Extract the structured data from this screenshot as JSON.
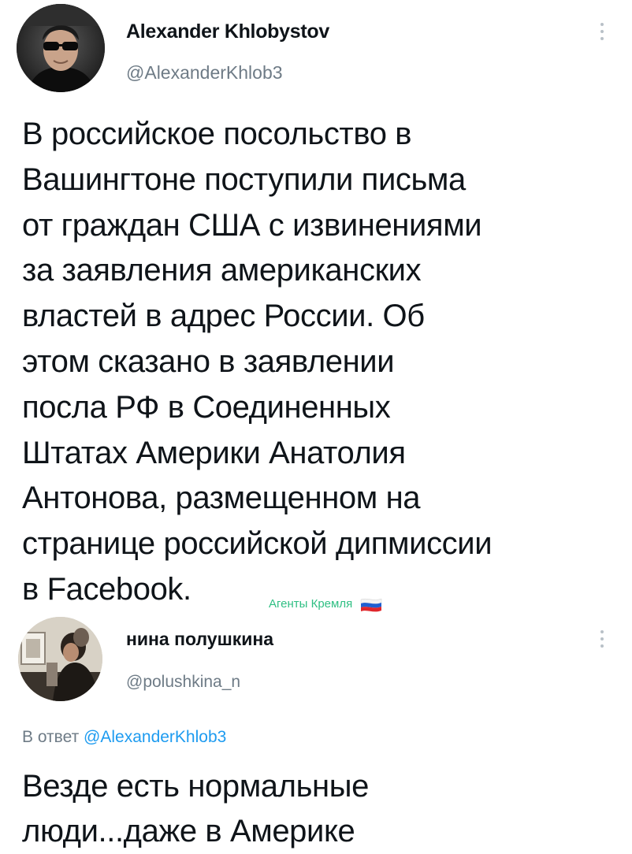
{
  "tweet1": {
    "author_name": "Alexander Khlobystov",
    "author_handle": "@AlexanderKhlob3",
    "text_lines": [
      "В российское посольство в",
      "Вашингтоне поступили письма",
      "от граждан США с извинениями",
      "за заявления американских",
      "властей в адрес России. Об",
      "этом сказано в заявлении",
      "посла РФ в Соединенных",
      "Штатах Америки Анатолия",
      "Антонова, размещенном на",
      "странице российской дипмиссии",
      "в Facebook."
    ],
    "more_icon": "more-vertical-icon"
  },
  "watermark": {
    "label": "Агенты Кремля",
    "flag_icon": "russian-flag-icon",
    "color": "#2fbf83"
  },
  "tweet2": {
    "author_name": "нина полушкина",
    "author_handle": "@polushkina_n",
    "replying_prefix": "В ответ",
    "replying_handle": "@AlexanderKhlob3",
    "text_lines": [
      "Везде есть нормальные",
      "люди...даже в Америке"
    ],
    "more_icon": "more-vertical-icon"
  },
  "colors": {
    "text": "#0f1419",
    "secondary": "#6e7b86",
    "link": "#1d9bf0",
    "background": "#ffffff"
  }
}
